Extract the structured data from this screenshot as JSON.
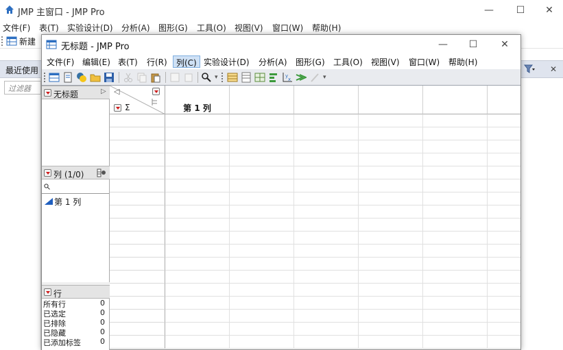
{
  "main_window": {
    "title": "JMP 主窗口 - JMP Pro",
    "menu": [
      "文件(F)",
      "表(T)",
      "实验设计(D)",
      "分析(A)",
      "图形(G)",
      "工具(O)",
      "视图(V)",
      "窗口(W)",
      "帮助(H)"
    ],
    "toolbar_new_label": "新建",
    "recent_header": "最近使用",
    "filter_placeholder": "过滤器"
  },
  "data_window": {
    "title": "无标题 - JMP Pro",
    "menu": [
      "文件(F)",
      "编辑(E)",
      "表(T)",
      "行(R)",
      "列(C)",
      "实验设计(D)",
      "分析(A)",
      "图形(G)",
      "工具(O)",
      "视图(V)",
      "窗口(W)",
      "帮助(H)"
    ],
    "active_menu_index": 4,
    "table_panel_title": "无标题",
    "columns_panel_title": "列 (1/0)",
    "columns_search_icon": "search-icon",
    "columns": [
      "第 1 列"
    ],
    "rows_panel_title": "行",
    "rows_stats": [
      {
        "label": "所有行",
        "value": "0"
      },
      {
        "label": "已选定",
        "value": "0"
      },
      {
        "label": "已排除",
        "value": "0"
      },
      {
        "label": "已隐藏",
        "value": "0"
      },
      {
        "label": "已添加标签",
        "value": "0"
      }
    ],
    "grid_column_headers": [
      "第 1 列"
    ],
    "sigma_symbol": "Σ"
  },
  "colors": {
    "accent_blue": "#1f5fbf",
    "menu_active_bg": "#cfe1f5",
    "header_bg": "#dfe4ee",
    "red_triangle": "#d01a1a"
  }
}
